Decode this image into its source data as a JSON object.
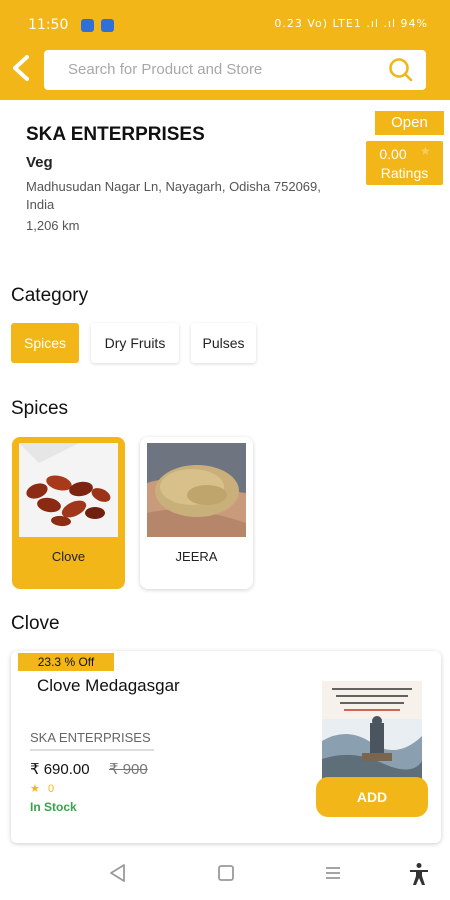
{
  "status_bar": {
    "time": "11:50",
    "right_text": "0.23 Vo) LTE1 .ıl .ıl 94%"
  },
  "header": {
    "search_placeholder": "Search for Product and Store"
  },
  "store": {
    "name": "SKA ENTERPRISES",
    "type": "Veg",
    "address": "Madhusudan Nagar Ln, Nayagarh, Odisha 752069, India",
    "distance": "1,206 km",
    "status": "Open",
    "rating_value": "0.00",
    "rating_label": "Ratings"
  },
  "category": {
    "title": "Category",
    "chips": [
      {
        "label": "Spices",
        "active": true
      },
      {
        "label": "Dry Fruits",
        "active": false
      },
      {
        "label": "Pulses",
        "active": false
      }
    ]
  },
  "subcategory": {
    "title": "Spices",
    "items": [
      {
        "label": "Clove",
        "active": true
      },
      {
        "label": "JEERA",
        "active": false
      }
    ]
  },
  "product_section": {
    "title": "Clove",
    "product": {
      "discount": "23.3 % Off",
      "name": "Clove Medagasgar",
      "seller": "SKA ENTERPRISES",
      "price": "₹ 690.00",
      "mrp": "₹ 900",
      "rating": "0",
      "stock": "In Stock",
      "add_label": "ADD"
    }
  },
  "colors": {
    "accent": "#f2b619",
    "stock_green": "#3aa24a"
  }
}
